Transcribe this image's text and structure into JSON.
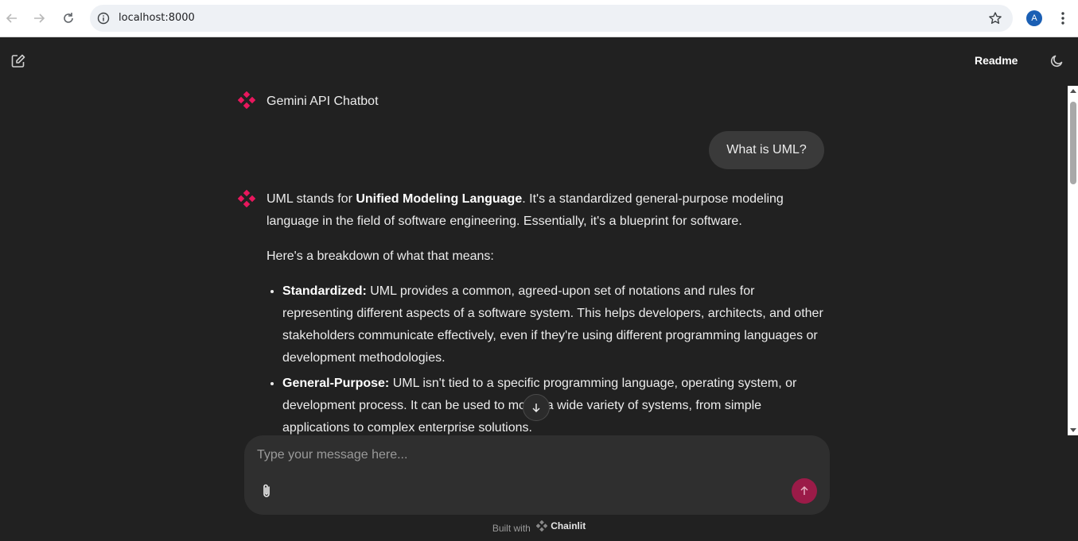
{
  "browser": {
    "url": "localhost:8000",
    "profile_initial": "A"
  },
  "header": {
    "readme_label": "Readme"
  },
  "chat": {
    "bot_name": "Gemini API Chatbot",
    "user_message": "What is UML?",
    "answer": {
      "p1_a": "UML stands for ",
      "p1_bold": "Unified Modeling Language",
      "p1_b": ". It's a standardized general-purpose modeling language in the field of software engineering.  Essentially, it's a blueprint for software.",
      "p2": "Here's a breakdown of what that means:",
      "bullets": [
        {
          "term": "Standardized:",
          "text": " UML provides a common, agreed-upon set of notations and rules for representing different aspects of a software system. This helps developers, architects, and other stakeholders communicate effectively, even if they're using different programming languages or development methodologies."
        },
        {
          "term": "General-Purpose:",
          "text": " UML isn't tied to a specific programming language, operating system, or development process. It can be used to model a wide variety of systems, from simple applications to complex enterprise solutions."
        }
      ]
    }
  },
  "composer": {
    "placeholder": "Type your message here..."
  },
  "footer": {
    "built_with": "Built with",
    "brand": "Chainlit"
  },
  "colors": {
    "background": "#212121",
    "accent": "#e8175d",
    "send_button": "#9b1b48"
  }
}
